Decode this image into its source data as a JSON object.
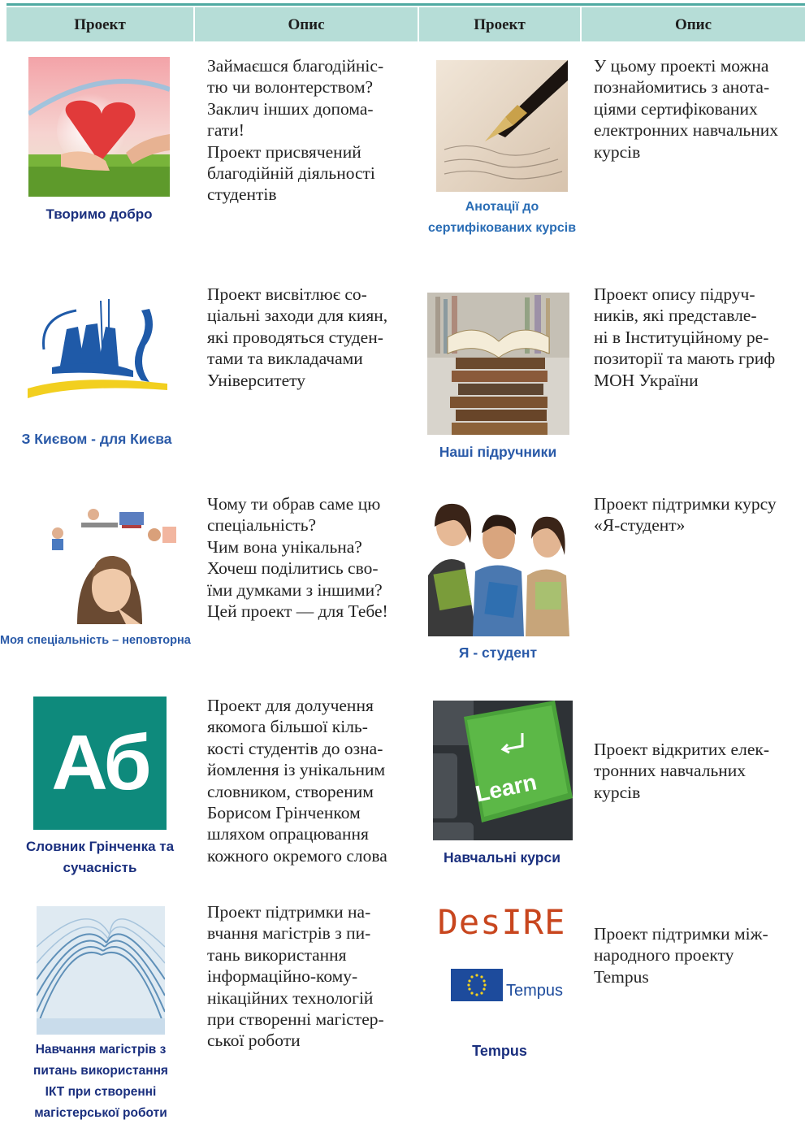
{
  "header": {
    "col1": "Проект",
    "col2": "Опис",
    "col3": "Проект",
    "col4": "Опис"
  },
  "projects": [
    {
      "caption": "Творимо добро",
      "image": "heart-hands-image",
      "description": "Займаєшся благодійніс-\nтю чи волонтерством?\nЗаклич інших допома-\nгати!\nПроект присвячений\nблагодійній діяльності\nстудентів"
    },
    {
      "caption": "Анотації до\nсертифікованих курсів",
      "image": "fountain-pen-image",
      "description": "У цьому проекті можна\nпознайомитись з анота-\nціями сертифікованих\nелектронних навчальних\nкурсів"
    },
    {
      "caption": "З Києвом - для Києва",
      "image": "kyiv-founders-monument-logo",
      "description": "Проект висвітлює со-\nціальні заходи для киян,\nякі проводяться студен-\nтами та викладачами\nУніверситету"
    },
    {
      "caption": "Наші підручники",
      "image": "book-stack-image",
      "description": "Проект опису підруч-\nників, які представле-\nні в Інституційному ре-\nпозиторії та мають гриф\nМОН України"
    },
    {
      "caption": "Моя спеціальність – неповторна",
      "image": "thinking-girl-collage",
      "description": "Чому ти обрав саме цю\nспеціальність?\nЧим вона унікальна?\nХочеш поділитись сво-\nїми думками з іншими?\nЦей проект — для Тебе!"
    },
    {
      "caption": "Я - студент",
      "image": "students-group-photo",
      "description": "Проект підтримки курсу\n«Я-студент»"
    },
    {
      "caption": "Словник Грінченка та\nсучасність",
      "image": "ab-dictionary-logo",
      "logo_text": "Аб",
      "description": "Проект для долучення\nякомога більшої кіль-\nкості студентів до озна-\nйомлення із унікальним\nсловником, створеним\nБорисом Грінченком\nшляхом опрацювання\nкожного окремого слова"
    },
    {
      "caption": "Навчальні курси",
      "image": "learn-keyboard-key",
      "key_text": "Learn",
      "description": "Проект відкритих елек-\nтронних навчальних\nкурсів"
    },
    {
      "caption": "Навчання магістрів з\nпитань використання\nІКТ при створенні\nмагістерської роботи",
      "image": "open-book-pages-image",
      "description": "Проект підтримки на-\nвчання магістрів з пи-\nтань використання\nінформаційно-кому-\nнікаційних технологій\nпри створенні магістер-\nської роботи"
    },
    {
      "caption": "Tempus",
      "image": "desire-tempus-logo",
      "logo_text_1": "DesIRE",
      "logo_text_2": "Tempus",
      "description": "Проект підтримки між-\nнародного проекту\nTempus"
    }
  ],
  "colors": {
    "header_bg": "#b6ddd7",
    "header_line": "#4fa9a1",
    "caption_dark": "#1a2f7e",
    "caption_light": "#2a6db5"
  }
}
